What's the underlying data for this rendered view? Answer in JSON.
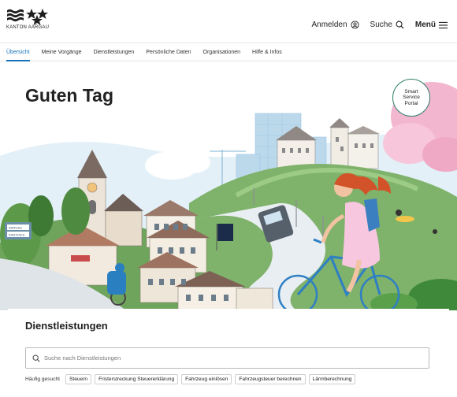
{
  "header": {
    "logo_text": "KANTON AARGAU",
    "login_label": "Anmelden",
    "search_label": "Suche",
    "menu_label": "Menü"
  },
  "nav": {
    "tabs": [
      {
        "label": "Übersicht",
        "active": true
      },
      {
        "label": "Meine Vorgänge"
      },
      {
        "label": "Dienstleistungen"
      },
      {
        "label": "Persönliche Daten"
      },
      {
        "label": "Organisationen"
      },
      {
        "label": "Hilfe & Infos"
      }
    ]
  },
  "hero": {
    "greeting": "Guten Tag",
    "badge": {
      "line1": "Smart",
      "line2": "Service",
      "line3": "Portal"
    },
    "sign_text_1": "AARGAU",
    "sign_text_2": "KANTON A"
  },
  "services": {
    "title": "Dienstleistungen",
    "search_placeholder": "Suche nach Dienstleistungen",
    "frequent_label": "Häufig gesucht",
    "chips": [
      "Steuern",
      "Fristerstreckung Steuererklärung",
      "Fahrzeug einlösen",
      "Fahrzeugsteuer berechnen",
      "Lärmberechnung"
    ]
  },
  "colors": {
    "accent": "#1672b8",
    "hill_green": "#7fb26a",
    "sky_blue": "#d7e9f4",
    "cherry_pink": "#f3b6cf"
  }
}
